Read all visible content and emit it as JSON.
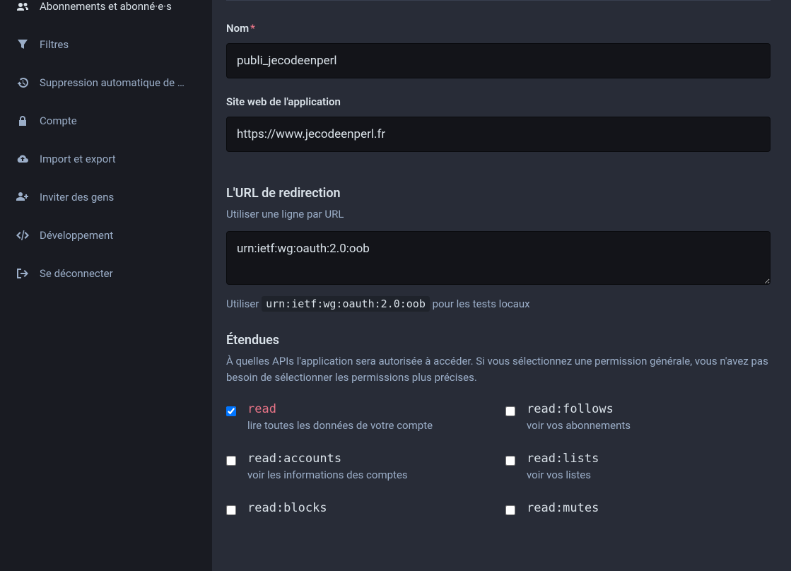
{
  "sidebar": {
    "items": [
      {
        "label": "Abonnements et abonné·e·s"
      },
      {
        "label": "Filtres"
      },
      {
        "label": "Suppression automatique de …"
      },
      {
        "label": "Compte"
      },
      {
        "label": "Import et export"
      },
      {
        "label": "Inviter des gens"
      },
      {
        "label": "Développement"
      },
      {
        "label": "Se déconnecter"
      }
    ]
  },
  "form": {
    "name_label": "Nom",
    "name_value": "publi_jecodeenperl",
    "website_label": "Site web de l'application",
    "website_value": "https://www.jecodeenperl.fr",
    "redirect_heading": "L'URL de redirection",
    "redirect_hint": "Utiliser une ligne par URL",
    "redirect_value": "urn:ietf:wg:oauth:2.0:oob",
    "redirect_below_pre": "Utiliser ",
    "redirect_below_code": "urn:ietf:wg:oauth:2.0:oob",
    "redirect_below_post": " pour les tests locaux",
    "scopes_heading": "Étendues",
    "scopes_hint": "À quelles APIs l'application sera autorisée à accéder. Si vous sélectionnez une permission générale, vous n'avez pas besoin de sélectionner les permissions plus précises.",
    "scopes": [
      {
        "name": "read",
        "desc": "lire toutes les données de votre compte",
        "checked": true,
        "highlight": true
      },
      {
        "name": "read:follows",
        "desc": "voir vos abonnements",
        "checked": false,
        "highlight": false
      },
      {
        "name": "read:accounts",
        "desc": "voir les informations des comptes",
        "checked": false,
        "highlight": false
      },
      {
        "name": "read:lists",
        "desc": "voir vos listes",
        "checked": false,
        "highlight": false
      },
      {
        "name": "read:blocks",
        "desc": "",
        "checked": false,
        "highlight": false
      },
      {
        "name": "read:mutes",
        "desc": "",
        "checked": false,
        "highlight": false
      }
    ]
  }
}
